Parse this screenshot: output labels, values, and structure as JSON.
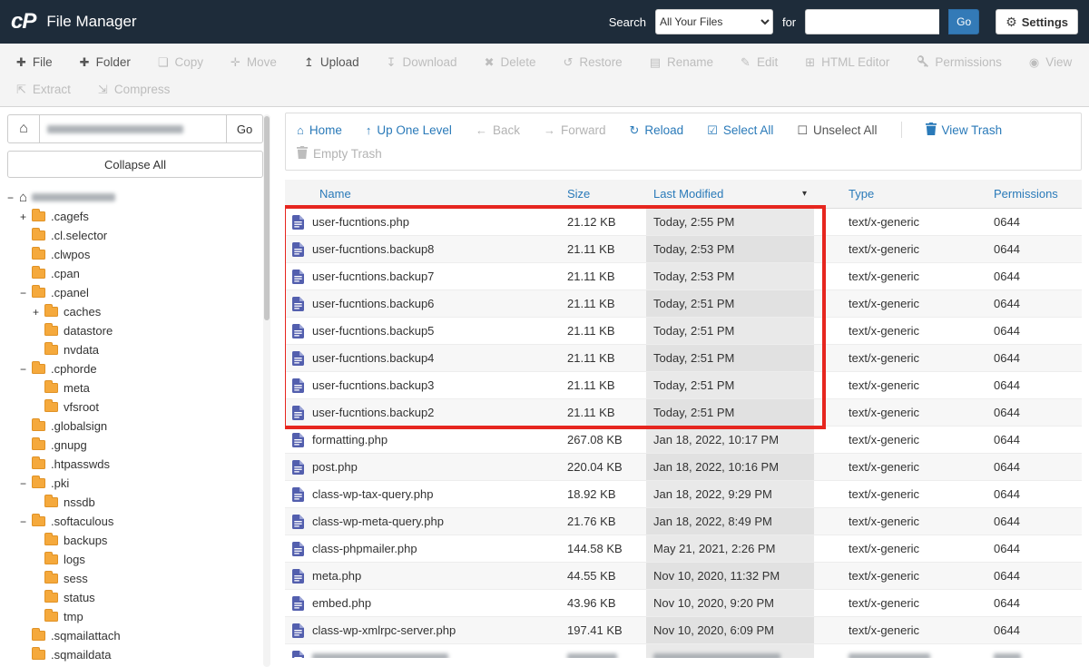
{
  "topbar": {
    "logo": "cP",
    "title": "File Manager",
    "search_label": "Search",
    "search_scope_selected": "All Your Files",
    "for_label": "for",
    "search_value": "",
    "go_label": "Go",
    "settings_label": "Settings",
    "settings_icon": "⚙"
  },
  "toolbar": {
    "items": [
      {
        "label": "File",
        "glyph": "✚",
        "row": 1,
        "enabled": true
      },
      {
        "label": "Folder",
        "glyph": "✚",
        "row": 1,
        "enabled": true
      },
      {
        "label": "Copy",
        "glyph": "❏",
        "row": 1,
        "enabled": false
      },
      {
        "label": "Move",
        "glyph": "✛",
        "row": 1,
        "enabled": false
      },
      {
        "label": "Upload",
        "glyph": "↥",
        "row": 1,
        "enabled": true
      },
      {
        "label": "Download",
        "glyph": "↧",
        "row": 1,
        "enabled": false
      },
      {
        "label": "Delete",
        "glyph": "✖",
        "row": 1,
        "enabled": false
      },
      {
        "label": "Restore",
        "glyph": "↺",
        "row": 1,
        "enabled": false
      },
      {
        "label": "Rename",
        "glyph": "▤",
        "row": 1,
        "enabled": false
      },
      {
        "label": "Edit",
        "glyph": "✎",
        "row": 1,
        "enabled": false
      },
      {
        "label": "HTML Editor",
        "glyph": "⊞",
        "row": 1,
        "enabled": false
      },
      {
        "label": "Permissions",
        "icon": "key",
        "row": 1,
        "enabled": false
      },
      {
        "label": "View",
        "glyph": "◉",
        "row": 1,
        "enabled": false
      },
      {
        "label": "Extract",
        "glyph": "⇱",
        "row": 2,
        "enabled": false
      },
      {
        "label": "Compress",
        "glyph": "⇲",
        "row": 2,
        "enabled": false
      }
    ]
  },
  "sidebar": {
    "home_icon": "⌂",
    "path_value_redacted": true,
    "path_go_label": "Go",
    "collapse_all_label": "Collapse All",
    "tree": [
      {
        "label": "",
        "redacted": true,
        "depth": 0,
        "expander": "−",
        "icon": "home"
      },
      {
        "label": ".cagefs",
        "depth": 1,
        "expander": "+",
        "icon": "folder"
      },
      {
        "label": ".cl.selector",
        "depth": 1,
        "expander": "",
        "icon": "folder"
      },
      {
        "label": ".clwpos",
        "depth": 1,
        "expander": "",
        "icon": "folder"
      },
      {
        "label": ".cpan",
        "depth": 1,
        "expander": "",
        "icon": "folder"
      },
      {
        "label": ".cpanel",
        "depth": 1,
        "expander": "−",
        "icon": "folder"
      },
      {
        "label": "caches",
        "depth": 2,
        "expander": "+",
        "icon": "folder"
      },
      {
        "label": "datastore",
        "depth": 2,
        "expander": "",
        "icon": "folder"
      },
      {
        "label": "nvdata",
        "depth": 2,
        "expander": "",
        "icon": "folder"
      },
      {
        "label": ".cphorde",
        "depth": 1,
        "expander": "−",
        "icon": "folder"
      },
      {
        "label": "meta",
        "depth": 2,
        "expander": "",
        "icon": "folder"
      },
      {
        "label": "vfsroot",
        "depth": 2,
        "expander": "",
        "icon": "folder"
      },
      {
        "label": ".globalsign",
        "depth": 1,
        "expander": "",
        "icon": "folder"
      },
      {
        "label": ".gnupg",
        "depth": 1,
        "expander": "",
        "icon": "folder"
      },
      {
        "label": ".htpasswds",
        "depth": 1,
        "expander": "",
        "icon": "folder"
      },
      {
        "label": ".pki",
        "depth": 1,
        "expander": "−",
        "icon": "folder"
      },
      {
        "label": "nssdb",
        "depth": 2,
        "expander": "",
        "icon": "folder"
      },
      {
        "label": ".softaculous",
        "depth": 1,
        "expander": "−",
        "icon": "folder"
      },
      {
        "label": "backups",
        "depth": 2,
        "expander": "",
        "icon": "folder"
      },
      {
        "label": "logs",
        "depth": 2,
        "expander": "",
        "icon": "folder"
      },
      {
        "label": "sess",
        "depth": 2,
        "expander": "",
        "icon": "folder"
      },
      {
        "label": "status",
        "depth": 2,
        "expander": "",
        "icon": "folder"
      },
      {
        "label": "tmp",
        "depth": 2,
        "expander": "",
        "icon": "folder"
      },
      {
        "label": ".sqmailattach",
        "depth": 1,
        "expander": "",
        "icon": "folder"
      },
      {
        "label": ".sqmaildata",
        "depth": 1,
        "expander": "",
        "icon": "folder"
      }
    ]
  },
  "filenav": {
    "links": [
      {
        "label": "Home",
        "glyph": "⌂",
        "style": "link"
      },
      {
        "label": "Up One Level",
        "glyph": "↑",
        "style": "link"
      },
      {
        "label": "Back",
        "glyph": "←",
        "style": "disabled"
      },
      {
        "label": "Forward",
        "glyph": "→",
        "style": "disabled"
      },
      {
        "label": "Reload",
        "glyph": "↻",
        "style": "link"
      },
      {
        "label": "Select All",
        "glyph": "☑",
        "style": "link"
      },
      {
        "label": "Unselect All",
        "glyph": "☐",
        "style": "dark"
      },
      {
        "type": "separator"
      },
      {
        "label": "View Trash",
        "icon": "trash",
        "style": "link"
      },
      {
        "type": "break"
      },
      {
        "label": "Empty Trash",
        "icon": "trash",
        "style": "disabled"
      }
    ]
  },
  "table": {
    "columns": [
      "Name",
      "Size",
      "Last Modified",
      "Type",
      "Permissions"
    ],
    "sort_column": "Last Modified",
    "sort_direction": "desc",
    "sort_glyph": "▾",
    "rows": [
      {
        "name": "user-fucntions.php",
        "size": "21.12 KB",
        "modified": "Today, 2:55 PM",
        "type": "text/x-generic",
        "permissions": "0644"
      },
      {
        "name": "user-fucntions.backup8",
        "size": "21.11 KB",
        "modified": "Today, 2:53 PM",
        "type": "text/x-generic",
        "permissions": "0644"
      },
      {
        "name": "user-fucntions.backup7",
        "size": "21.11 KB",
        "modified": "Today, 2:53 PM",
        "type": "text/x-generic",
        "permissions": "0644"
      },
      {
        "name": "user-fucntions.backup6",
        "size": "21.11 KB",
        "modified": "Today, 2:51 PM",
        "type": "text/x-generic",
        "permissions": "0644"
      },
      {
        "name": "user-fucntions.backup5",
        "size": "21.11 KB",
        "modified": "Today, 2:51 PM",
        "type": "text/x-generic",
        "permissions": "0644"
      },
      {
        "name": "user-fucntions.backup4",
        "size": "21.11 KB",
        "modified": "Today, 2:51 PM",
        "type": "text/x-generic",
        "permissions": "0644"
      },
      {
        "name": "user-fucntions.backup3",
        "size": "21.11 KB",
        "modified": "Today, 2:51 PM",
        "type": "text/x-generic",
        "permissions": "0644"
      },
      {
        "name": "user-fucntions.backup2",
        "size": "21.11 KB",
        "modified": "Today, 2:51 PM",
        "type": "text/x-generic",
        "permissions": "0644"
      },
      {
        "name": "formatting.php",
        "size": "267.08 KB",
        "modified": "Jan 18, 2022, 10:17 PM",
        "type": "text/x-generic",
        "permissions": "0644"
      },
      {
        "name": "post.php",
        "size": "220.04 KB",
        "modified": "Jan 18, 2022, 10:16 PM",
        "type": "text/x-generic",
        "permissions": "0644"
      },
      {
        "name": "class-wp-tax-query.php",
        "size": "18.92 KB",
        "modified": "Jan 18, 2022, 9:29 PM",
        "type": "text/x-generic",
        "permissions": "0644"
      },
      {
        "name": "class-wp-meta-query.php",
        "size": "21.76 KB",
        "modified": "Jan 18, 2022, 8:49 PM",
        "type": "text/x-generic",
        "permissions": "0644"
      },
      {
        "name": "class-phpmailer.php",
        "size": "144.58 KB",
        "modified": "May 21, 2021, 2:26 PM",
        "type": "text/x-generic",
        "permissions": "0644"
      },
      {
        "name": "meta.php",
        "size": "44.55 KB",
        "modified": "Nov 10, 2020, 11:32 PM",
        "type": "text/x-generic",
        "permissions": "0644"
      },
      {
        "name": "embed.php",
        "size": "43.96 KB",
        "modified": "Nov 10, 2020, 9:20 PM",
        "type": "text/x-generic",
        "permissions": "0644"
      },
      {
        "name": "class-wp-xmlrpc-server.php",
        "size": "197.41 KB",
        "modified": "Nov 10, 2020, 6:09 PM",
        "type": "text/x-generic",
        "permissions": "0644"
      }
    ],
    "partial_row_clipped": true
  },
  "annotation": {
    "highlight_box": {
      "color": "#e6261f",
      "row_start": 1,
      "row_count": 8
    }
  },
  "colors": {
    "topbar_bg": "#1e2c3a",
    "link_blue": "#2a7ab9",
    "go_button_blue": "#337ab7",
    "highlight_red": "#e6261f",
    "folder_orange": "#f5a93c",
    "file_icon_indigo": "#535fae",
    "sorted_cell_gray": "#e9e9e9"
  }
}
